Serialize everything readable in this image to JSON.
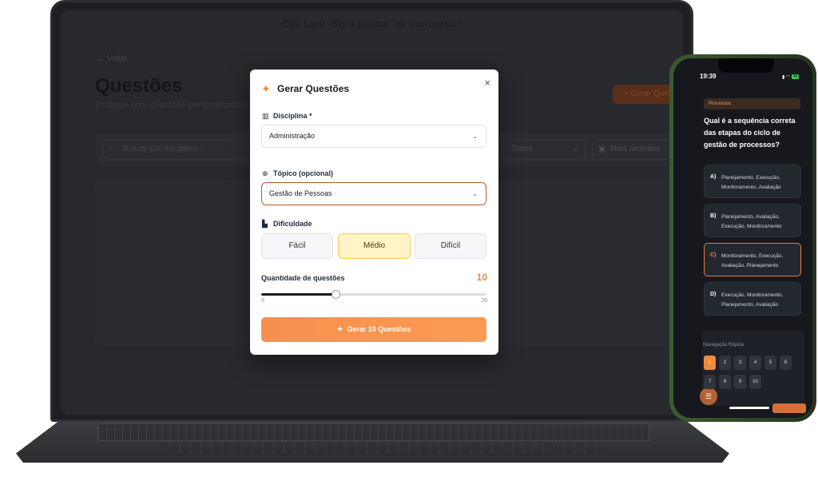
{
  "app": {
    "greeting": "Olá, Lani. Bora passar no concurso?",
    "back_label": "← Voltar",
    "page_title": "Questões",
    "page_subtitle": "Pratique com questões personalizadas",
    "generate_label": "+ Gerar Questões",
    "search_placeholder": "Buscar por disciplina...",
    "filter_todos": "Todos",
    "sort_label": "Mais recentes"
  },
  "modal": {
    "title": "Gerar Questões",
    "close": "×",
    "disciplina_label": "Disciplina *",
    "disciplina_value": "Administração",
    "topico_label": "Tópico (opcional)",
    "topico_value": "Gestão de Pessoas",
    "dificuldade_label": "Dificuldade",
    "difficulties": [
      "Fácil",
      "Médio",
      "Difícil"
    ],
    "selected_difficulty": "Médio",
    "quantidade_label": "Quantidade de questões",
    "quantidade_value": "10",
    "slider": {
      "min": "5",
      "max": "20",
      "value": 10,
      "fraction": 0.33
    },
    "submit_label": "Gerar 10 Questões"
  },
  "phone": {
    "time": "19:39",
    "battery": "46",
    "tag": "Processos",
    "question": "Qual é a sequência correta das etapas do ciclo de gestão de processos?",
    "options": [
      {
        "key": "A)",
        "text": "Planejamento, Execução, Monitoramento, Avaliação"
      },
      {
        "key": "B)",
        "text": "Planejamento, Avaliação, Execução, Monitoramento"
      },
      {
        "key": "C)",
        "text": "Monitoramento, Execução, Avaliação, Planejamento"
      },
      {
        "key": "D)",
        "text": "Execução, Monitoramento, Planejamento, Avaliação"
      }
    ],
    "selected_option": "C)",
    "nav_label": "Navegação Rápida",
    "nav_numbers": [
      "1",
      "2",
      "3",
      "4",
      "5",
      "6",
      "7",
      "8",
      "9",
      "10"
    ],
    "current_question": "1",
    "menu_icon": "☰"
  },
  "colors": {
    "accent": "#f08a3c",
    "selected_difficulty_bg": "#fff4c7",
    "phone_frame": "#3c5a2f"
  }
}
